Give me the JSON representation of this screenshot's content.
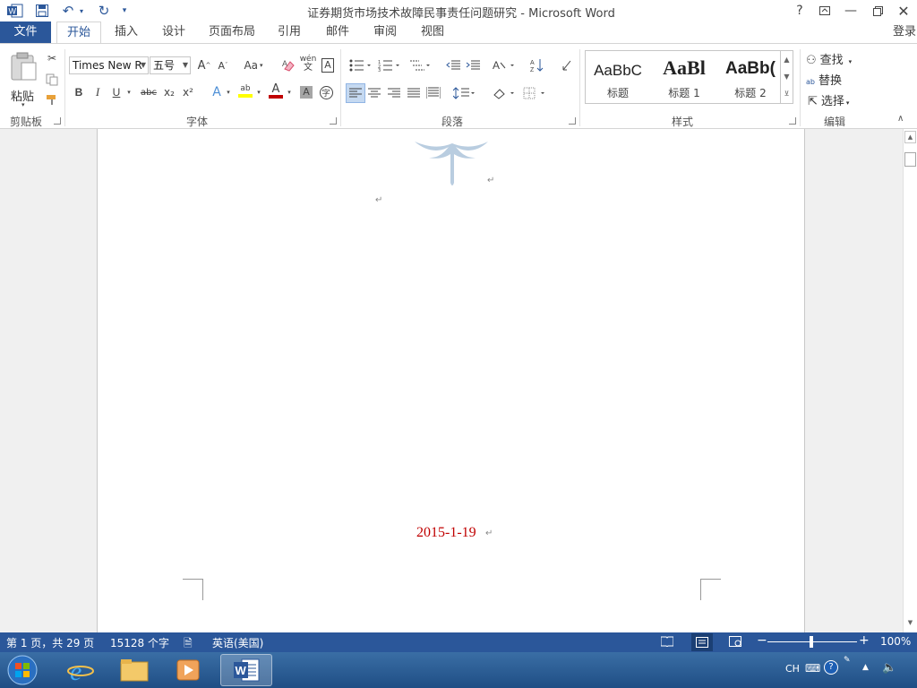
{
  "window": {
    "title": "证券期货市场技术故障民事责任问题研究 - Microsoft Word",
    "help": "?",
    "login": "登录"
  },
  "tabs": [
    "文件",
    "开始",
    "插入",
    "设计",
    "页面布局",
    "引用",
    "邮件",
    "审阅",
    "视图"
  ],
  "ribbon": {
    "clipboard": {
      "paste_label": "粘贴",
      "group_label": "剪贴板"
    },
    "font": {
      "name": "Times New R",
      "size": "五号",
      "group_label": "字体",
      "bold": "B",
      "italic": "I",
      "underline": "U",
      "strike": "abc",
      "sub": "x₂",
      "sup": "x²",
      "grow": "A",
      "shrink": "A",
      "case": "Aa",
      "pinyin": "wén",
      "border_char": "A",
      "shade_char": "A",
      "circle_char": "字",
      "highlight_color": "#ffff00",
      "font_color": "#c00000"
    },
    "paragraph": {
      "group_label": "段落"
    },
    "styles": {
      "group_label": "样式",
      "items": [
        {
          "sample": "AaBbC",
          "name": "标题"
        },
        {
          "sample": "AaBl",
          "name": "标题 1"
        },
        {
          "sample": "AaBb(",
          "name": "标题 2"
        }
      ]
    },
    "editing": {
      "group_label": "编辑",
      "find": "查找",
      "replace": "替换",
      "select": "选择"
    }
  },
  "document": {
    "date": "2015-1-19",
    "para_mark": "↵"
  },
  "status": {
    "page": "第 1 页，共 29 页",
    "words": "15128 个字",
    "language": "英语(美国)",
    "zoom": "100%"
  },
  "taskbar": {
    "lang": "CH"
  },
  "colors": {
    "accent": "#2b579a",
    "date_text": "#c00000",
    "logo": "#b9cde0"
  }
}
